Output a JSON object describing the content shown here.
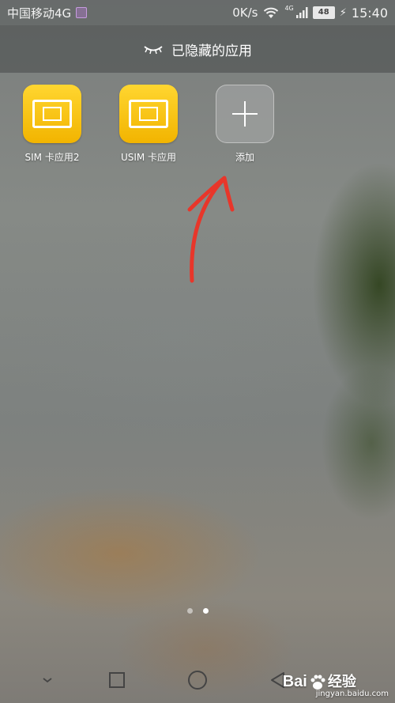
{
  "status_bar": {
    "carrier": "中国移动4G",
    "net_speed": "0K/s",
    "network_type": "4G",
    "battery_level": "48",
    "battery_percent": 48,
    "clock": "15:40"
  },
  "header": {
    "title": "已隐藏的应用",
    "icon": "closed-eye-icon"
  },
  "apps": [
    {
      "label": "SIM 卡应用2",
      "icon": "sim-card-icon"
    },
    {
      "label": "USIM 卡应用",
      "icon": "sim-card-icon"
    },
    {
      "label": "添加",
      "icon": "plus-icon"
    }
  ],
  "page_indicator": {
    "count": 2,
    "active_index": 1
  },
  "nav_bar": {
    "items": [
      "chevron-down-icon",
      "recent-apps-icon",
      "home-icon",
      "back-icon"
    ]
  },
  "watermark": {
    "brand": "Bai",
    "brand_suffix": "经验",
    "url": "jingyan.baidu.com"
  },
  "colors": {
    "app_icon_yellow": "#f7c51a",
    "annotation_arrow": "#e8362a"
  }
}
